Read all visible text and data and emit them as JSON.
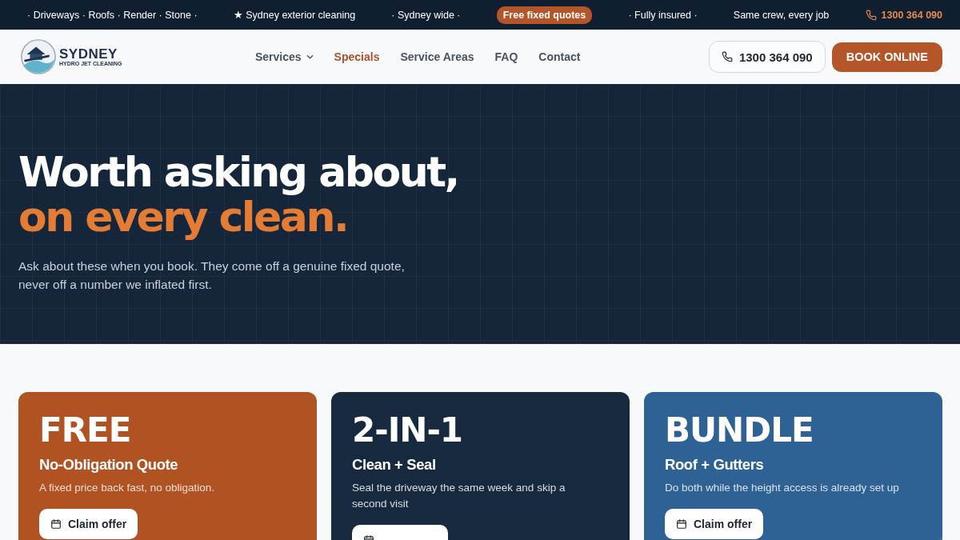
{
  "top_bar": {
    "items": [
      {
        "kind": "text",
        "text": "· Driveways · Roofs · Render · Stone ·"
      },
      {
        "kind": "text",
        "text": "★ Sydney exterior cleaning"
      },
      {
        "kind": "text",
        "text": "· Sydney wide ·"
      },
      {
        "kind": "pill",
        "text": "Free fixed quotes"
      },
      {
        "kind": "text",
        "text": "· Fully insured ·"
      },
      {
        "kind": "text",
        "text": "Same crew, every job"
      },
      {
        "kind": "phone",
        "text": "1300 364 090"
      }
    ]
  },
  "header": {
    "logo": {
      "name": "SYDNEY",
      "tagline": "HYDRO JET CLEANING"
    },
    "nav": [
      {
        "label": "Services",
        "selected": false,
        "dropdown": true
      },
      {
        "label": "Specials",
        "selected": true,
        "dropdown": false
      },
      {
        "label": "Service Areas",
        "selected": false,
        "dropdown": false
      },
      {
        "label": "FAQ",
        "selected": false,
        "dropdown": false
      },
      {
        "label": "Contact",
        "selected": false,
        "dropdown": false
      }
    ],
    "phone_button": "1300 364 090",
    "book_button": "BOOK ONLINE"
  },
  "hero": {
    "title_line_1": "Worth asking about,",
    "title_line_2": "on every clean.",
    "text": "Ask about these when you book. They come off a genuine fixed quote, never off a number we inflated first."
  },
  "offers": [
    {
      "badge": "FREE",
      "title": "No-Obligation Quote",
      "text": "A fixed price back fast, no obligation.",
      "button": "Claim offer",
      "color": "#b05222",
      "shine": false
    },
    {
      "badge": "2-IN-1",
      "title": "Clean + Seal",
      "text": "Seal the driveway the same week and skip a second visit",
      "color": "#17293f",
      "shine": false
    },
    {
      "badge": "BUNDLE",
      "title": "Roof + Gutters",
      "text": "Do both while the height access is already set up",
      "button": "Claim offer",
      "color": "#2e6194",
      "shine": true
    }
  ]
}
